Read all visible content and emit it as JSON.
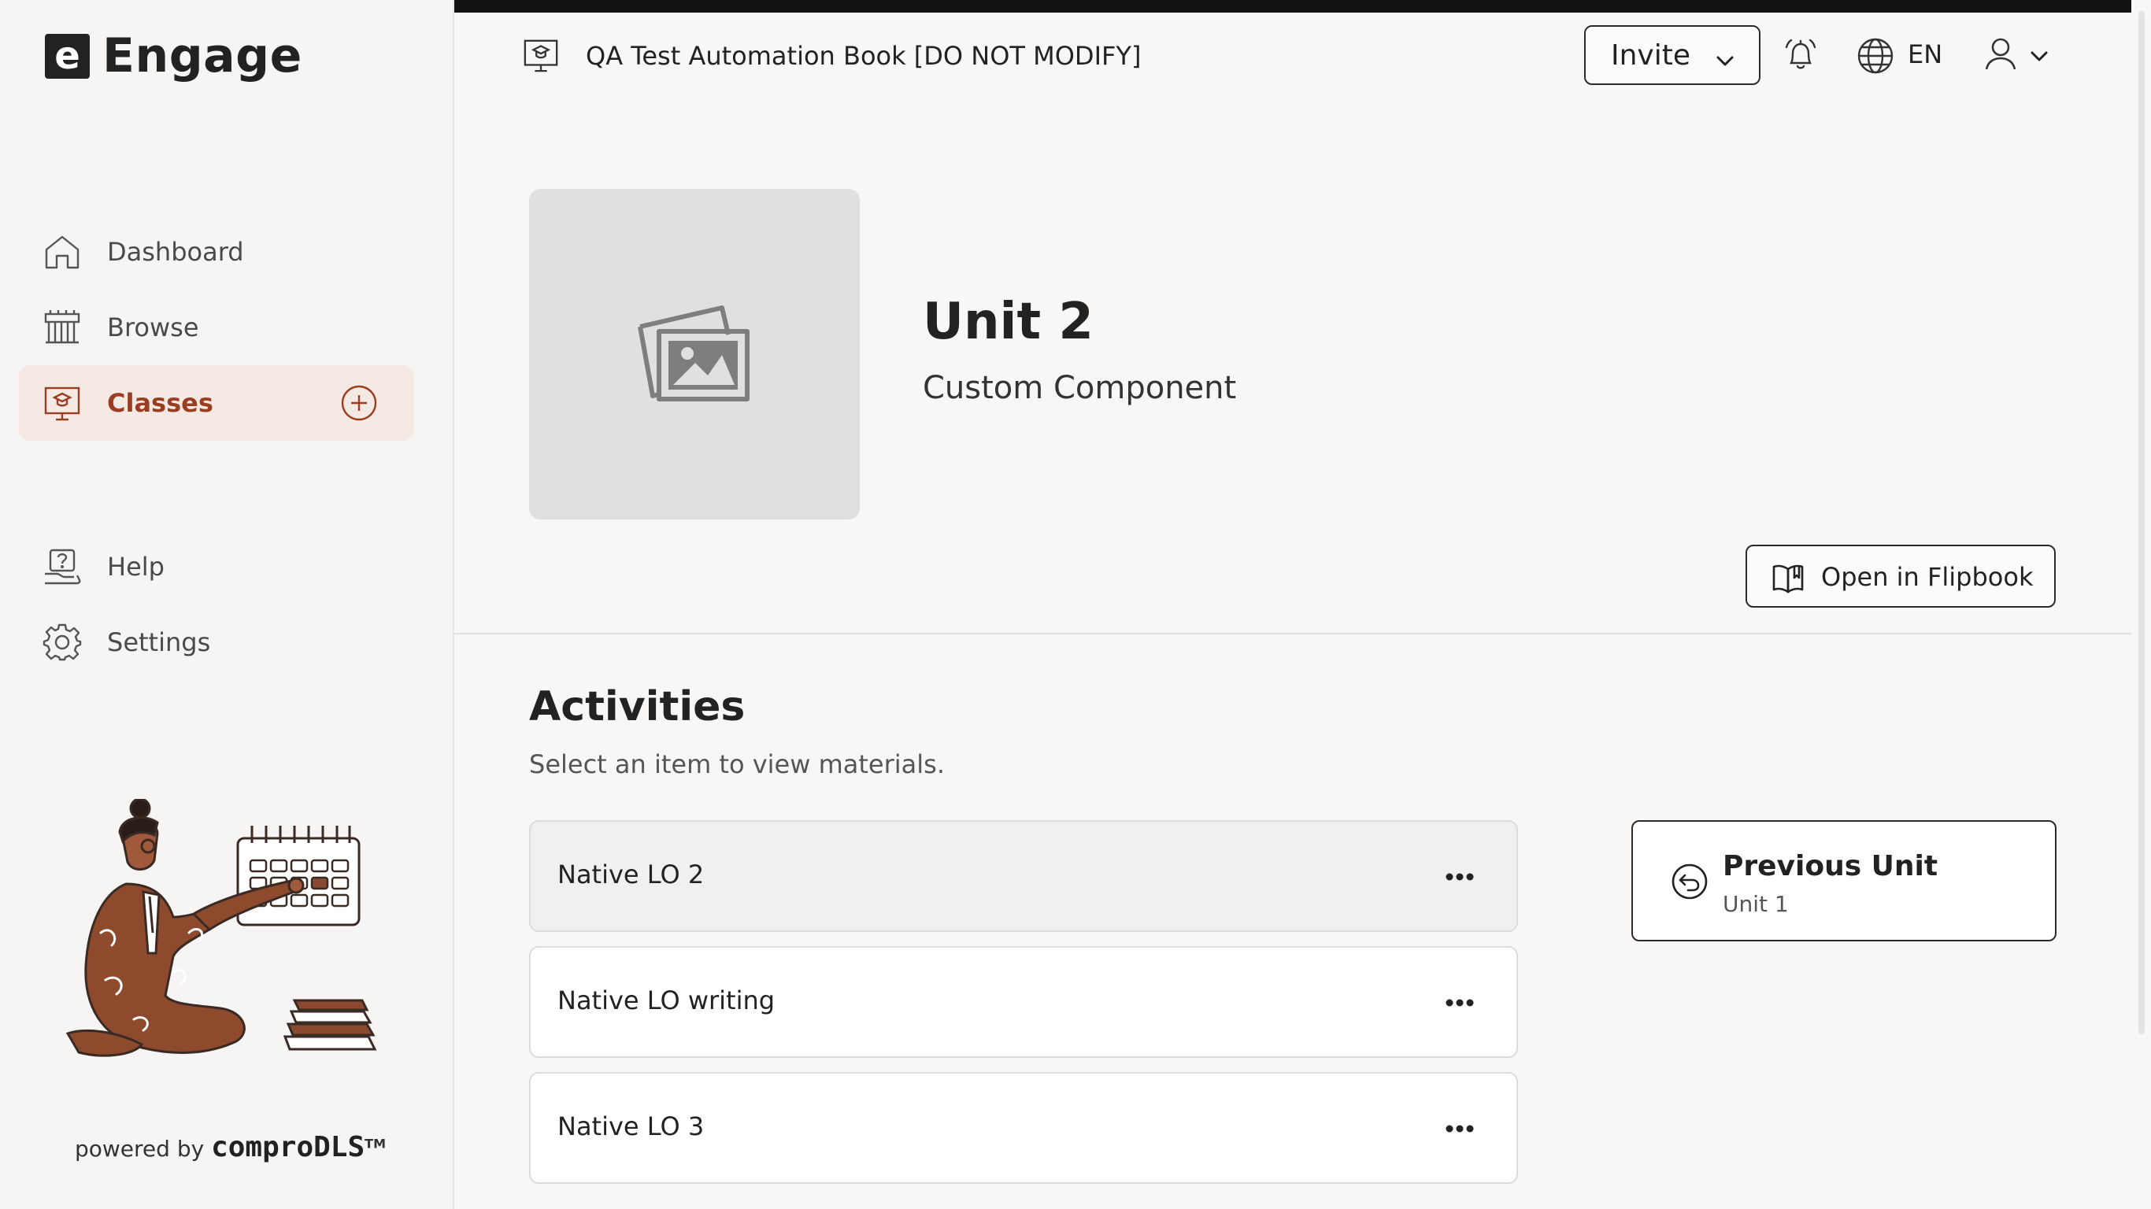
{
  "app": {
    "brand_letter": "e",
    "name": "Engage"
  },
  "sidebar": {
    "items": [
      {
        "label": "Dashboard",
        "icon": "home-icon"
      },
      {
        "label": "Browse",
        "icon": "library-icon"
      },
      {
        "label": "Classes",
        "icon": "classroom-icon",
        "active": true
      },
      {
        "label": "Help",
        "icon": "help-icon"
      },
      {
        "label": "Settings",
        "icon": "gear-icon"
      }
    ],
    "powered_prefix": "powered by",
    "powered_brand": "comproDLS",
    "powered_tm": "TM"
  },
  "header": {
    "book_title": "QA Test Automation Book [DO NOT MODIFY]",
    "invite_label": "Invite",
    "language": "EN"
  },
  "unit": {
    "title": "Unit 2",
    "subtitle": "Custom Component",
    "open_flipbook_label": "Open in Flipbook"
  },
  "activities": {
    "title": "Activities",
    "subtitle": "Select an item to view materials.",
    "items": [
      {
        "label": "Native LO 2"
      },
      {
        "label": "Native LO writing"
      },
      {
        "label": "Native LO 3"
      }
    ]
  },
  "previous_unit": {
    "title": "Previous Unit",
    "subtitle": "Unit 1"
  },
  "colors": {
    "accent": "#9a3e22",
    "active_bg": "#f5e9e4",
    "placeholder_bg": "#e1e0df"
  }
}
